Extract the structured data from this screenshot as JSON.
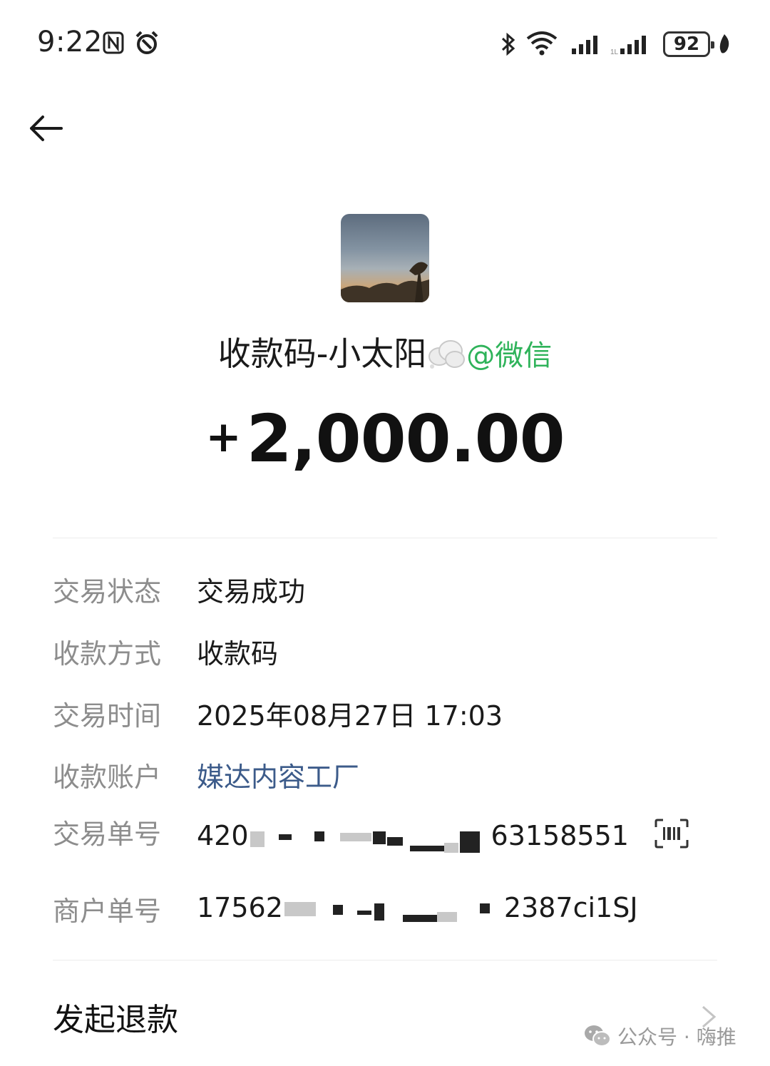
{
  "status_bar": {
    "time": "9:22",
    "battery": "92",
    "icons": [
      "nfc-icon",
      "alarm-icon",
      "bluetooth-icon",
      "wifi-icon",
      "signal-icon",
      "signal-icon",
      "battery-icon",
      "leaf-icon"
    ]
  },
  "header": {
    "back_icon": "arrow-left-icon"
  },
  "merchant": {
    "name": "收款码-小太阳",
    "emoji": "cloud-emoji",
    "tag": "@微信"
  },
  "amount": {
    "sign": "+",
    "value": "2,000.00"
  },
  "details": [
    {
      "label": "交易状态",
      "value": "交易成功"
    },
    {
      "label": "收款方式",
      "value": "收款码"
    },
    {
      "label": "交易时间",
      "value": "2025年08月27日 17:03"
    },
    {
      "label": "收款账户",
      "value": "媒达内容工厂"
    },
    {
      "label": "交易单号",
      "value_prefix": "420",
      "value_suffix": "63158551",
      "icon": "barcode-icon"
    },
    {
      "label": "商户单号",
      "value_prefix": "17562",
      "value_suffix": "2387ci1SJ"
    }
  ],
  "refund": {
    "label": "发起退款",
    "icon": "chevron-right-icon"
  },
  "watermark": {
    "text": "公众号 · 嗨推",
    "icon": "wechat-icon"
  },
  "colors": {
    "link": "#3c5b8a",
    "wechat_green": "#2fb35a",
    "label_gray": "#8d8d8d"
  }
}
